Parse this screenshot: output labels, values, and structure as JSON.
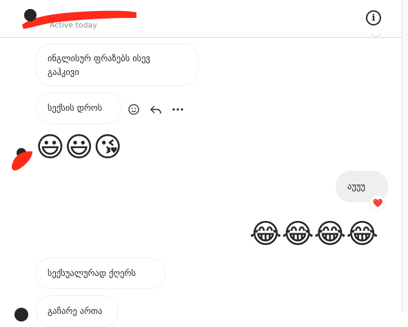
{
  "header": {
    "status": "Active today"
  },
  "messages": {
    "m1_line1": "ინგლისურ ფრაზებს ისევ",
    "m1_line2": "გაჰკივი",
    "m2": "სექსის დროს",
    "m3_emojis": "😃😃😘",
    "m4": "აუუუ",
    "m4_reaction": "❤️",
    "m5_emojis": "😂😂😂😂",
    "m6": "სექსუალურად ქღერს",
    "m7": "გაჩარე ართა"
  },
  "icons": [
    "info-icon",
    "emoji-icon",
    "reply-icon",
    "more-icon",
    "heart-icon"
  ]
}
